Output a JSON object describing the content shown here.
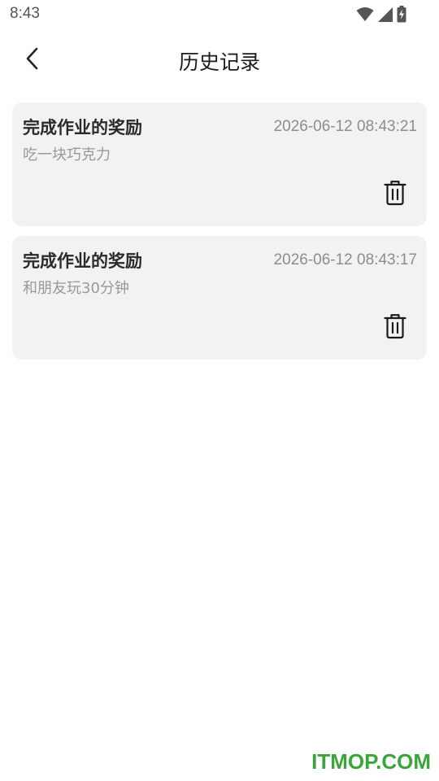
{
  "status_bar": {
    "time": "8:43",
    "icons": [
      "wifi-icon",
      "cell-signal-icon",
      "battery-charging-icon"
    ]
  },
  "header": {
    "back_icon": "chevron-left-icon",
    "title": "历史记录"
  },
  "records": [
    {
      "title": "完成作业的奖励",
      "timestamp": "2026-06-12 08:43:21",
      "description": "吃一块巧克力",
      "action_icon": "trash-icon"
    },
    {
      "title": "完成作业的奖励",
      "timestamp": "2026-06-12 08:43:17",
      "description": "和朋友玩30分钟",
      "action_icon": "trash-icon"
    }
  ],
  "watermark": "ITMOP.COM",
  "colors": {
    "card_background": "#f2f2f2",
    "watermark": "#3aa63a",
    "secondary_text": "#999999"
  }
}
